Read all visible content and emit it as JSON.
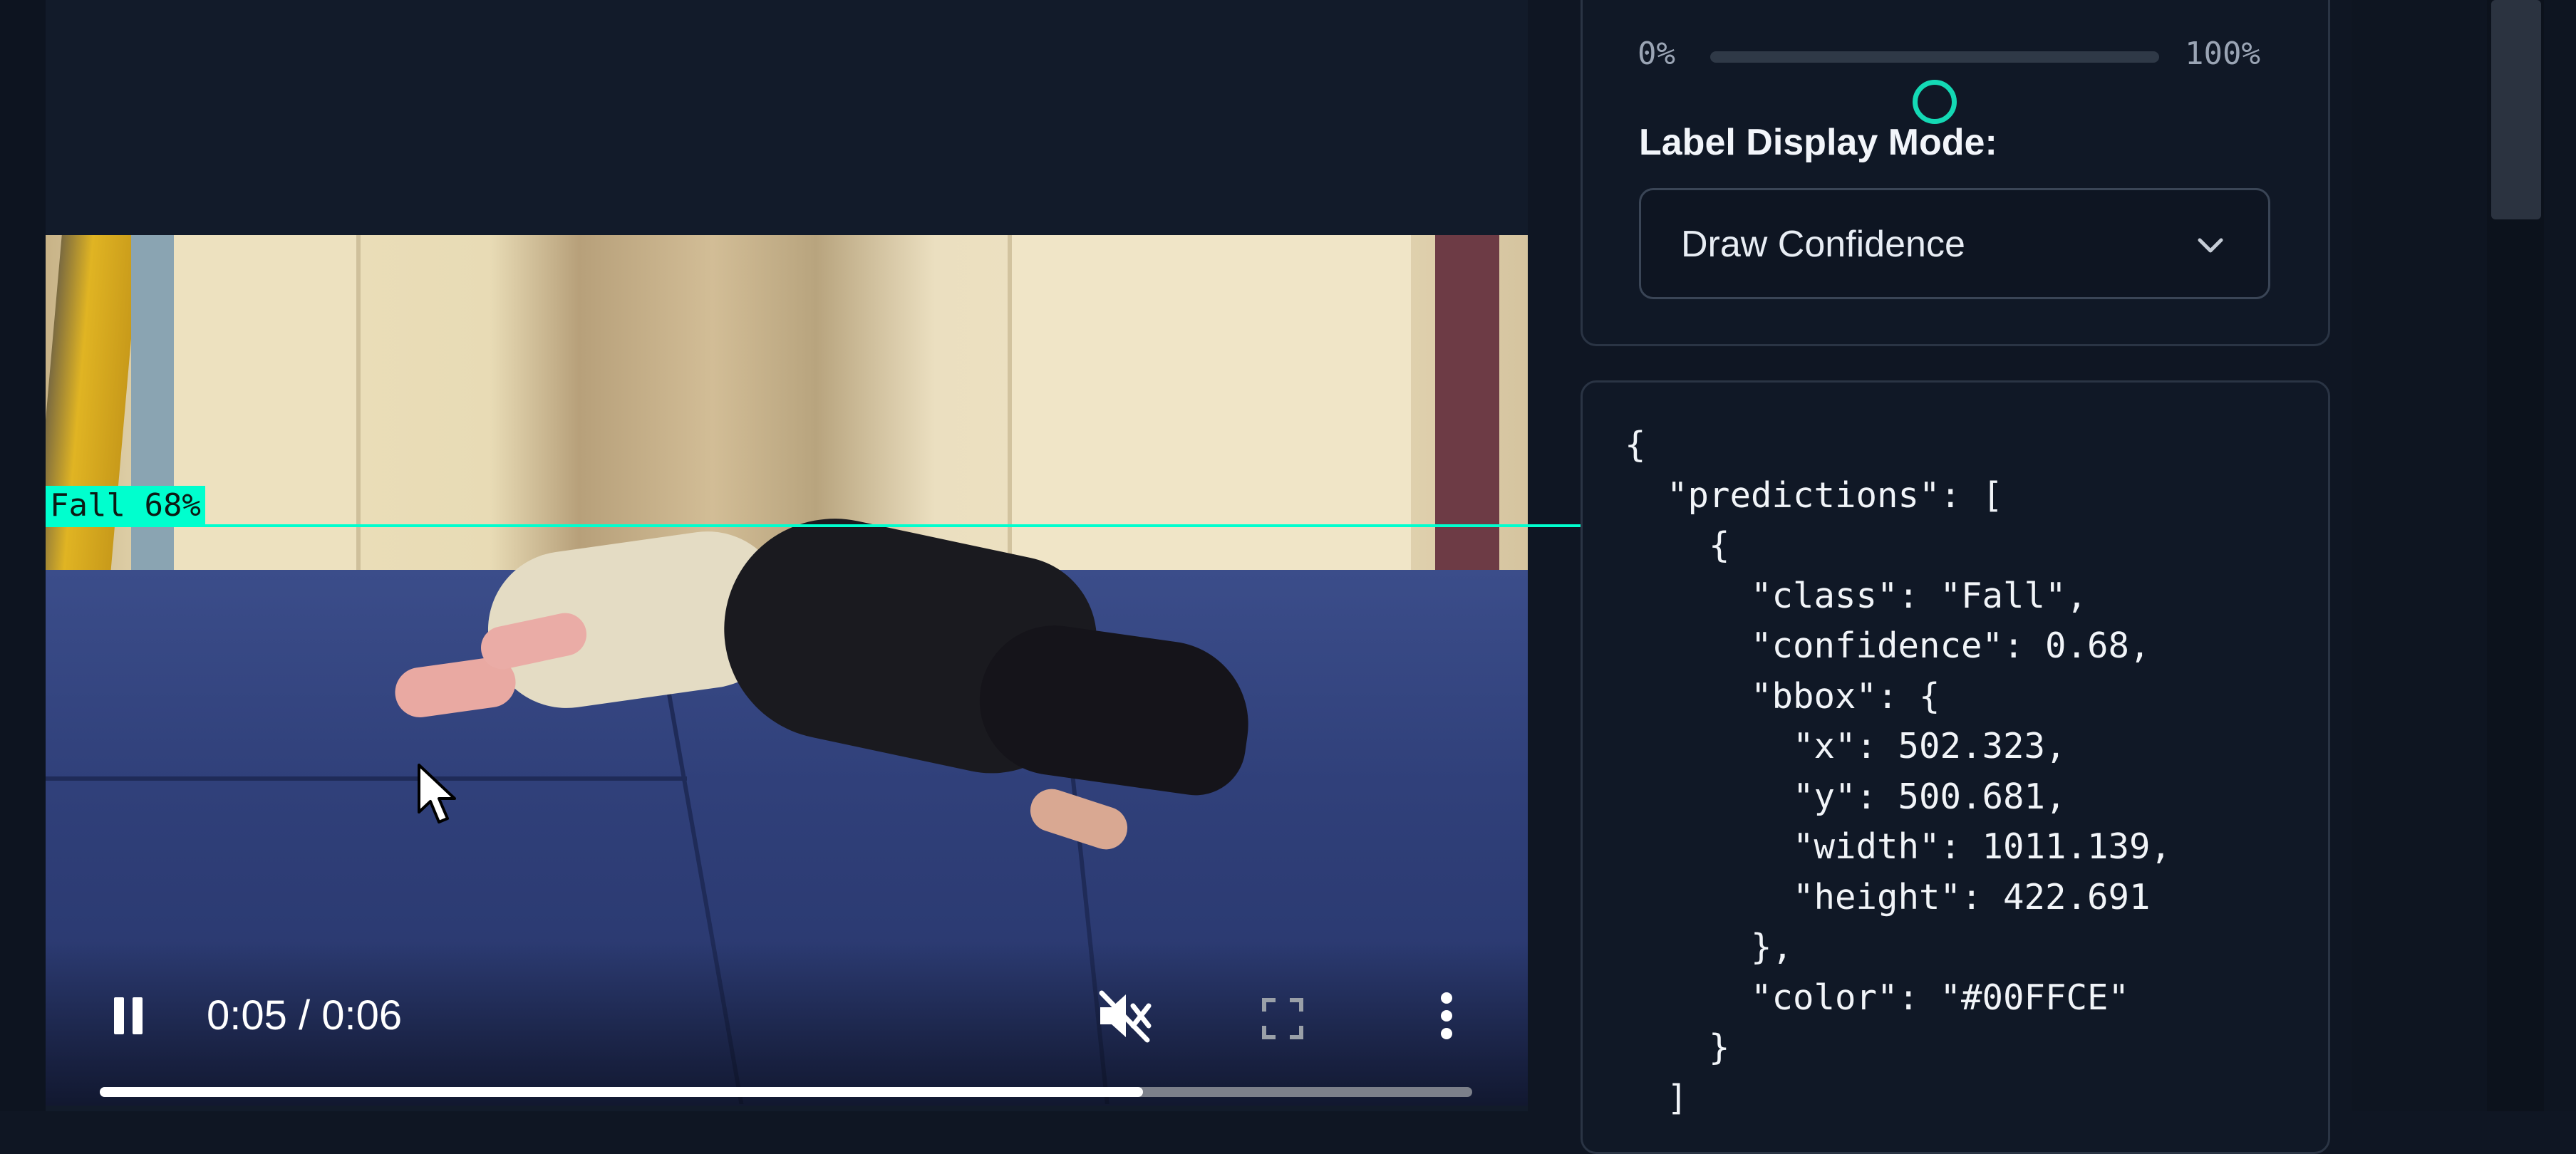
{
  "video": {
    "detection_label": "Fall 68%",
    "time_display": "0:05 / 0:06",
    "progress": 0.76,
    "icons": {
      "pause": "pause-icon",
      "mute": "volume-muted-icon",
      "fullscreen": "fullscreen-icon",
      "more": "more-vertical-icon"
    }
  },
  "settings": {
    "slider": {
      "min_label": "0%",
      "max_label": "100%",
      "value": 0.5
    },
    "label_display_mode": {
      "label": "Label Display Mode:",
      "selected": "Draw Confidence"
    },
    "accent_color": "#14D9B5"
  },
  "predictions_json": "{\n  \"predictions\": [\n    {\n      \"class\": \"Fall\",\n      \"confidence\": 0.68,\n      \"bbox\": {\n        \"x\": 502.323,\n        \"y\": 500.681,\n        \"width\": 1011.139,\n        \"height\": 422.691\n      },\n      \"color\": \"#00FFCE\"\n    }\n  ]",
  "detection_color": "#00FFCE"
}
